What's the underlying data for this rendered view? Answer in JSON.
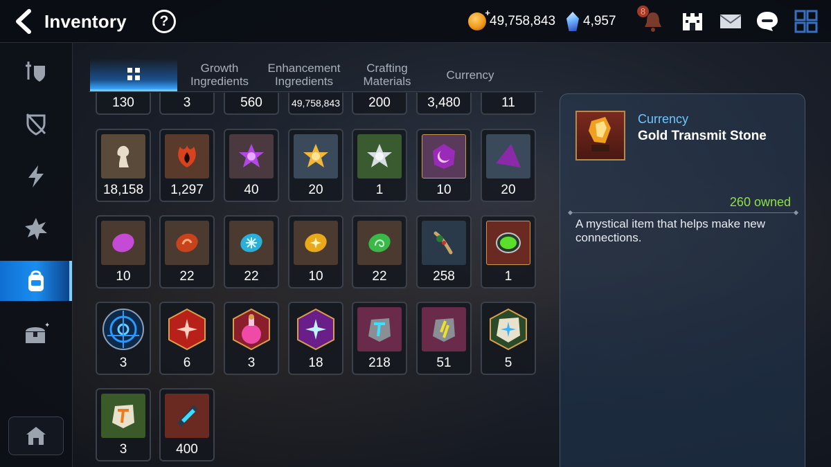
{
  "header": {
    "title": "Inventory",
    "help_label": "?",
    "gold": "49,758,843",
    "crystals": "4,957",
    "notification_count": "8"
  },
  "tabs": [
    {
      "label": "",
      "icon": "grid-icon",
      "active": true
    },
    {
      "label": "Growth Ingredients"
    },
    {
      "label": "Enhancement Ingredients"
    },
    {
      "label": "Crafting Materials"
    },
    {
      "label": "Currency"
    }
  ],
  "sidebar": [
    {
      "icon": "hero-shield-icon"
    },
    {
      "icon": "crossed-shield-icon"
    },
    {
      "icon": "lightning-icon"
    },
    {
      "icon": "burst-icon"
    },
    {
      "icon": "backpack-icon",
      "active": true
    },
    {
      "icon": "chest-icon"
    },
    {
      "icon": "house-icon"
    }
  ],
  "items": {
    "row0": [
      "130",
      "3",
      "560",
      "49,758,843",
      "200",
      "3,480",
      "11"
    ],
    "row1": [
      "18,158",
      "1,297",
      "40",
      "20",
      "1",
      "10",
      "20"
    ],
    "row2": [
      "10",
      "22",
      "22",
      "10",
      "22",
      "258",
      "1"
    ],
    "row3": [
      "3",
      "6",
      "3",
      "18",
      "218",
      "51",
      "5"
    ],
    "row4": [
      "3",
      "400"
    ]
  },
  "detail": {
    "category": "Currency",
    "name": "Gold Transmit Stone",
    "owned": "260 owned",
    "description": "A mystical item that helps make new connections."
  },
  "colors": {
    "accent_blue": "#1b8df0",
    "owned_green": "#8fe04a",
    "category_blue": "#6ec6ff"
  }
}
